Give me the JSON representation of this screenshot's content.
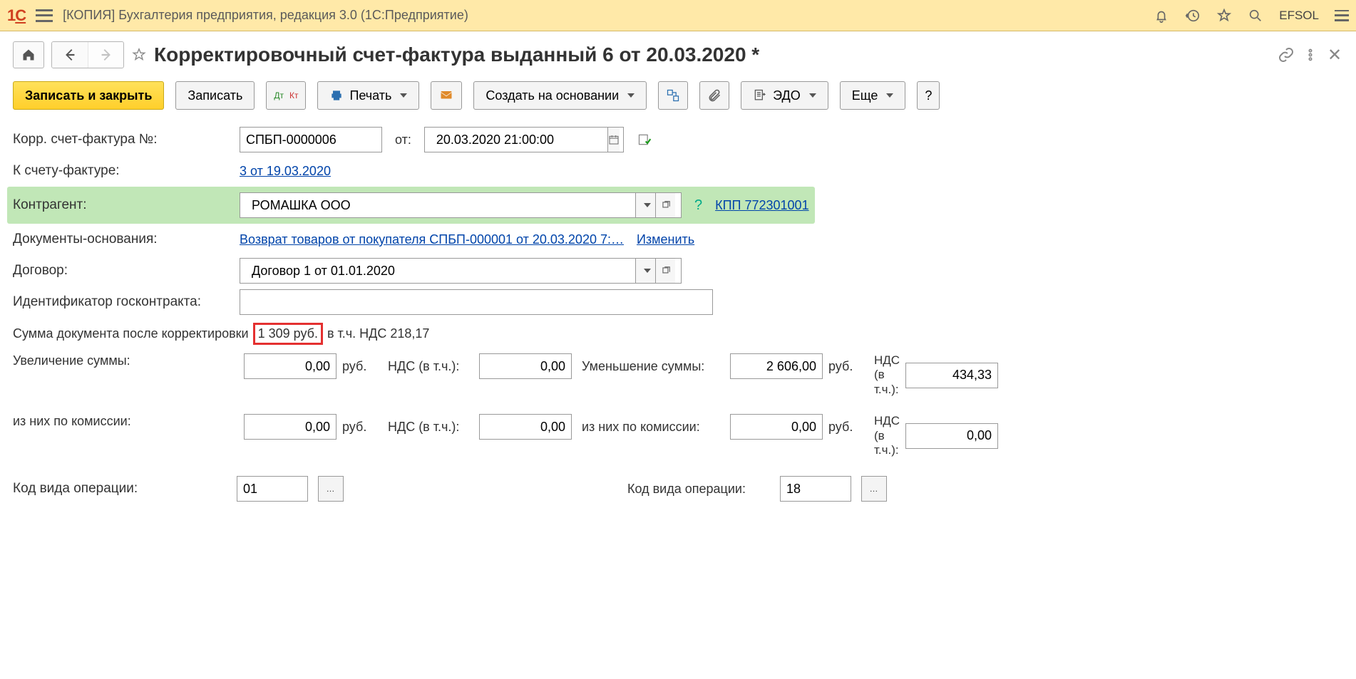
{
  "app": {
    "brand": "1C",
    "title": "[КОПИЯ] Бухгалтерия предприятия, редакция 3.0   (1С:Предприятие)",
    "user": "EFSOL"
  },
  "doc": {
    "title": "Корректировочный счет-фактура выданный 6 от 20.03.2020 *"
  },
  "toolbar": {
    "save_close": "Записать и закрыть",
    "save": "Записать",
    "print": "Печать",
    "create_based": "Создать на основании",
    "edo": "ЭДО",
    "more": "Еще",
    "help": "?"
  },
  "form": {
    "corr_sf_label": "Корр. счет-фактура №:",
    "corr_sf_value": "СПБП-0000006",
    "from_label": "от:",
    "date_value": "20.03.2020 21:00:00",
    "to_sf_label": "К счету-фактуре:",
    "to_sf_link": "3 от 19.03.2020",
    "counterparty_label": "Контрагент:",
    "counterparty_value": "РОМАШКА ООО",
    "kpp_link": "КПП 772301001",
    "kpp_question": "?",
    "basis_label": "Документы-основания:",
    "basis_link": "Возврат товаров от покупателя СПБП-000001 от 20.03.2020 7:…",
    "basis_edit": "Изменить",
    "contract_label": "Договор:",
    "contract_value": "Договор 1 от 01.01.2020",
    "gov_id_label": "Идентификатор госконтракта:",
    "gov_id_value": "",
    "sum_after_label": "Сумма документа после корректировки",
    "sum_after_amount": "1 309 руб.",
    "sum_after_tail": "в т.ч. НДС 218,17"
  },
  "sums": {
    "increase_label": "Увеличение суммы:",
    "increase_value": "0,00",
    "currency": "руб.",
    "nds_inc_label": "НДС (в т.ч.):",
    "nds_inc_value": "0,00",
    "decrease_label": "Уменьшение суммы:",
    "decrease_value": "2 606,00",
    "nds_dec_label": "НДС (в т.ч.):",
    "nds_dec_value": "434,33",
    "comm_label": "из них по комиссии:",
    "comm_inc_value": "0,00",
    "comm_nds_inc_value": "0,00",
    "comm_dec_value": "0,00",
    "comm_nds_dec_value": "0,00"
  },
  "opcode": {
    "left_label": "Код вида операции:",
    "left_value": "01",
    "right_label": "Код вида операции:",
    "right_value": "18"
  }
}
